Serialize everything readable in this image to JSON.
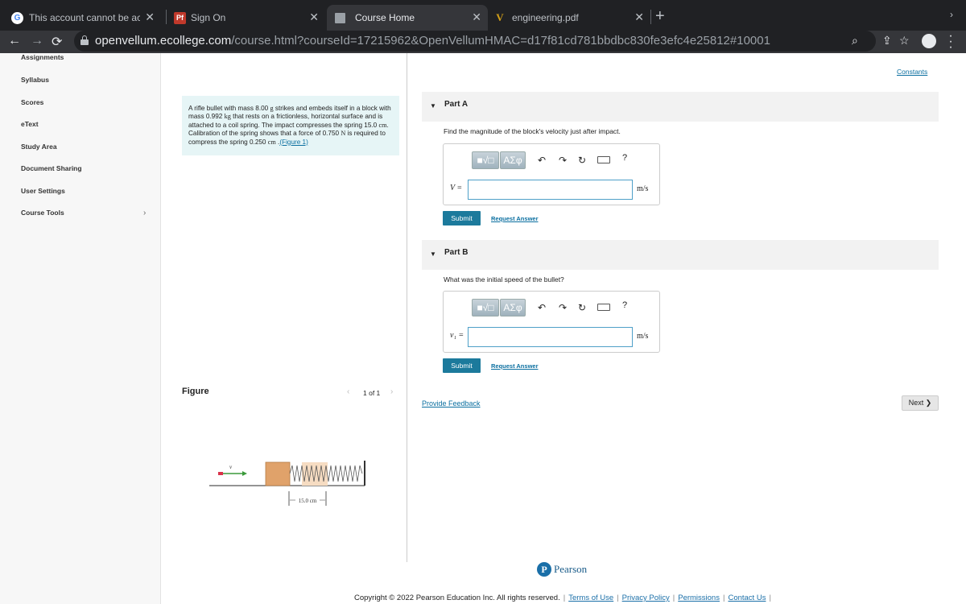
{
  "browser": {
    "tabs": [
      {
        "title": "This account cannot be access",
        "favicon": "G"
      },
      {
        "title": "Sign On",
        "favicon": "Pf"
      },
      {
        "title": "Course Home",
        "favicon": ""
      },
      {
        "title": "engineering.pdf",
        "favicon": "V"
      }
    ],
    "url_domain": "openvellum.ecollege.com",
    "url_path": "/course.html?courseId=17215962&OpenVellumHMAC=d17f81cd781bbdbc830fe3efc4e25812#10001"
  },
  "sidebar": {
    "items": [
      {
        "label": "Assignments"
      },
      {
        "label": "Syllabus"
      },
      {
        "label": "Scores"
      },
      {
        "label": "eText"
      },
      {
        "label": "Study Area"
      },
      {
        "label": "Document Sharing"
      },
      {
        "label": "User Settings"
      },
      {
        "label": "Course Tools"
      }
    ]
  },
  "problem": {
    "text_1": "A rifle bullet with mass 8.00 ",
    "unit_g": "g",
    "text_2": " strikes and embeds itself in a block with mass 0.992 ",
    "unit_kg": "kg",
    "text_3": " that rests on a frictionless, horizontal surface and is attached to a coil spring. The impact compresses the spring 15.0 ",
    "unit_cm": "cm",
    "text_4": ". Calibration of the spring shows that a force of 0.750 ",
    "unit_N": "N",
    "text_5": " is required to compress the spring 0.250 ",
    "unit_cm2": "cm",
    "text_6": " .",
    "figure_link": "(Figure 1)"
  },
  "figure": {
    "title": "Figure",
    "count": "1 of 1",
    "velocity_label": "v",
    "dimension_label": "15.0 cm"
  },
  "constants_link": "Constants",
  "part_a": {
    "label": "Part A",
    "question": "Find the magnitude of the block's velocity just after impact.",
    "var_label": "V =",
    "unit": "m/s",
    "template_btn": "■√□",
    "greek_btn": "ΑΣφ",
    "help": "?",
    "submit": "Submit",
    "request": "Request Answer"
  },
  "part_b": {
    "label": "Part B",
    "question": "What was the initial speed of the bullet?",
    "var_label": "v₁ =",
    "unit": "m/s",
    "template_btn": "■√□",
    "greek_btn": "ΑΣφ",
    "help": "?",
    "submit": "Submit",
    "request": "Request Answer"
  },
  "feedback_link": "Provide Feedback",
  "next_label": "Next ❯",
  "footer": {
    "brand": "Pearson",
    "brand_initial": "P",
    "copyright": "Copyright © 2022 Pearson Education Inc. All rights reserved.",
    "links": [
      "Terms of Use",
      "Privacy Policy",
      "Permissions",
      "Contact Us"
    ]
  }
}
